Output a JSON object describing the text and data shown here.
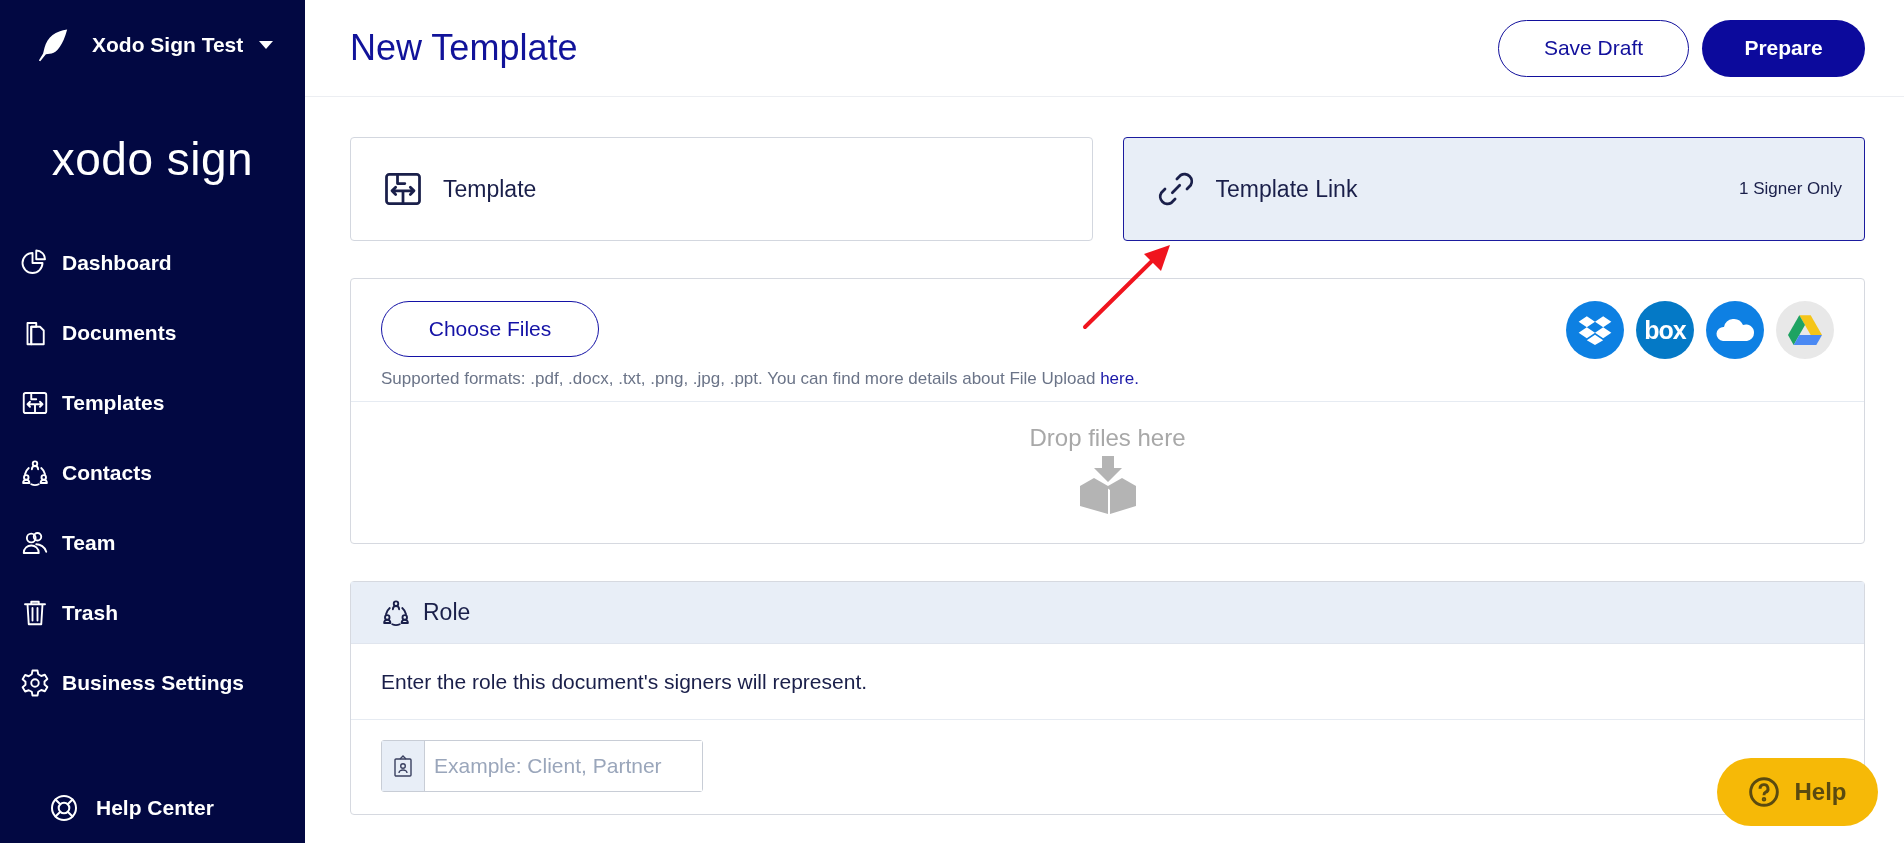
{
  "workspace": {
    "name": "Xodo Sign Test"
  },
  "brand": "xodo sign",
  "nav": [
    {
      "label": "Dashboard",
      "kind": "pie"
    },
    {
      "label": "Documents",
      "kind": "documents"
    },
    {
      "label": "Templates",
      "kind": "template"
    },
    {
      "label": "Contacts",
      "kind": "contacts"
    },
    {
      "label": "Team",
      "kind": "team"
    },
    {
      "label": "Trash",
      "kind": "trash"
    },
    {
      "label": "Business Settings",
      "kind": "gear"
    }
  ],
  "help_center": "Help Center",
  "header": {
    "title": "New Template",
    "buttons": [
      {
        "label": "Save Draft",
        "kind": "outline"
      },
      {
        "label": "Prepare",
        "kind": "primary"
      }
    ]
  },
  "template_types": [
    {
      "label": "Template",
      "kind": "template",
      "selected": false
    },
    {
      "label": "Template Link",
      "kind": "link",
      "note": "1 Signer Only",
      "selected": true
    }
  ],
  "upload": {
    "button": "Choose Files",
    "formats": "Supported formats: .pdf, .docx, .txt, .png, .jpg, .ppt. You can find more details about File Upload ",
    "link": "here.",
    "cloud_sources": [
      {
        "kind": "dropbox"
      },
      {
        "kind": "box",
        "label": "box"
      },
      {
        "kind": "onedrive"
      },
      {
        "kind": "drive"
      }
    ],
    "drop_text": "Drop files here"
  },
  "role": {
    "title": "Role",
    "description": "Enter the role this document's signers will represent.",
    "placeholder": "Example: Client, Partner"
  },
  "help_button": "Help"
}
